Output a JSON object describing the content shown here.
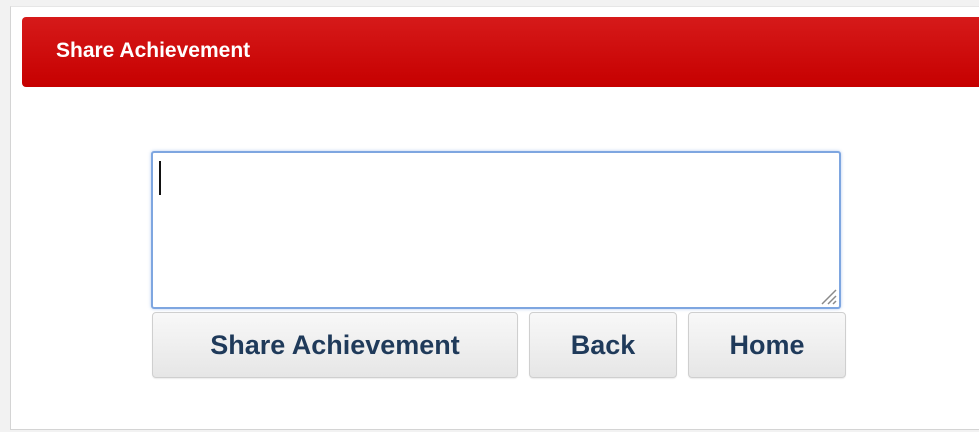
{
  "header": {
    "title": "Share Achievement"
  },
  "share_form": {
    "message_value": "",
    "message_placeholder": ""
  },
  "buttons": {
    "share_label": "Share Achievement",
    "back_label": "Back",
    "home_label": "Home"
  },
  "colors": {
    "header_red": "#c60000",
    "button_text": "#1f3a5a",
    "focus_border": "#7ea6e0"
  },
  "icons": {
    "resize_grip": "resize-grip-icon"
  }
}
